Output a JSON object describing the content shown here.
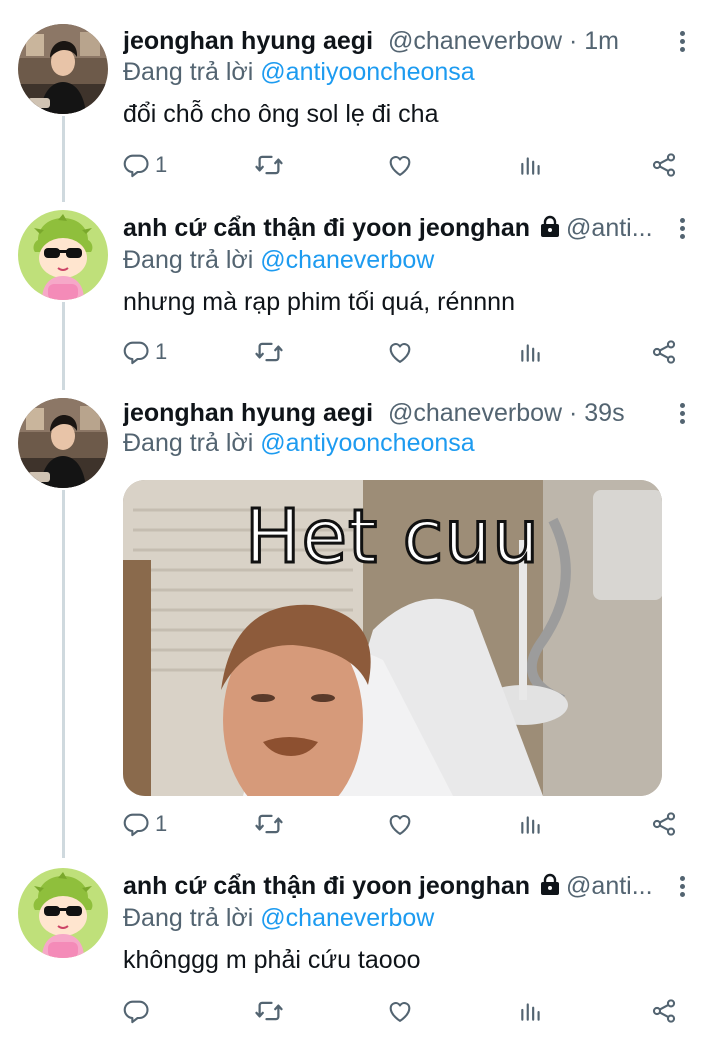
{
  "tweets": [
    {
      "name": "jeonghan hyung aegi",
      "handle": "@chaneverbow · 1m",
      "replying_prefix": "Đang trả lời ",
      "replying_to": "@antiyooncheonsa",
      "text": "đổi chỗ cho ông sol lẹ đi cha",
      "reply_count": "1",
      "locked": false
    },
    {
      "name": "anh cứ cẩn thận đi yoon jeonghan",
      "handle": "@anti...",
      "replying_prefix": "Đang trả lời ",
      "replying_to": "@chaneverbow",
      "text": "nhưng mà rạp phim tối quá, rénnnn",
      "reply_count": "1",
      "locked": true
    },
    {
      "name": "jeonghan hyung aegi",
      "handle": "@chaneverbow · 39s",
      "replying_prefix": "Đang trả lời ",
      "replying_to": "@antiyooncheonsa",
      "media_caption": "Het cuu",
      "reply_count": "1",
      "locked": false
    },
    {
      "name": "anh cứ cẩn thận đi yoon jeonghan",
      "handle": "@anti...",
      "replying_prefix": "Đang trả lời ",
      "replying_to": "@chaneverbow",
      "text": "khônggg m phải cứu taooo",
      "reply_count": "",
      "locked": true
    }
  ],
  "colors": {
    "text_primary": "#0f1419",
    "text_secondary": "#536471",
    "link": "#1d9bf0",
    "thread_line": "#cfd9de"
  },
  "icons": [
    "reply-icon",
    "retweet-icon",
    "like-icon",
    "analytics-icon",
    "share-icon",
    "more-icon",
    "lock-icon"
  ]
}
